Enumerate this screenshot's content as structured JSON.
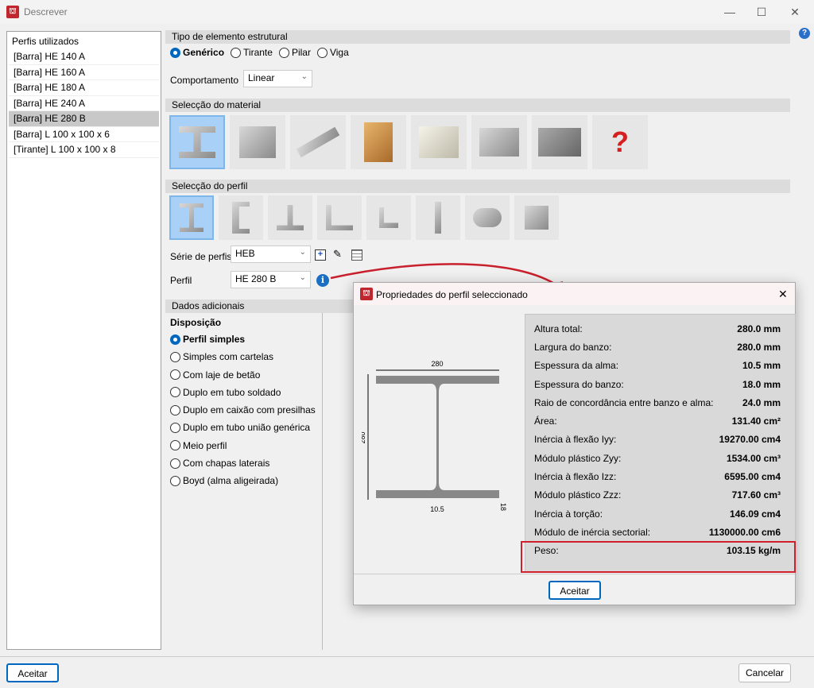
{
  "window": {
    "title": "Descrever",
    "help": "?"
  },
  "profiles_list": {
    "header": "Perfis utilizados",
    "items": [
      "[Barra] HE 140 A",
      "[Barra] HE 160 A",
      "[Barra] HE 180 A",
      "[Barra] HE 240 A",
      "[Barra] HE 280 B",
      "[Barra] L 100 x 100 x 6",
      "[Tirante] L 100 x 100 x 8"
    ],
    "selected_index": 4
  },
  "element_type": {
    "title": "Tipo de elemento estrutural",
    "options": [
      "Genérico",
      "Tirante",
      "Pilar",
      "Viga"
    ],
    "selected": "Genérico"
  },
  "behaviour": {
    "label": "Comportamento",
    "value": "Linear"
  },
  "material": {
    "title": "Selecção do material",
    "icons": [
      "steel-rolled-icon",
      "steel-welded-icon",
      "cold-formed-icon",
      "timber-icon",
      "aluminium-extruded-icon",
      "aluminium-profiles-icon",
      "concrete-icon",
      "generic-section-icon"
    ],
    "selected_index": 0
  },
  "profile_select": {
    "title": "Selecção do perfil",
    "icons": [
      "i-section-icon",
      "c-section-icon",
      "t-section-icon",
      "l-section-icon",
      "small-l-section-icon",
      "plate-icon",
      "round-bar-icon",
      "square-bar-icon"
    ],
    "selected_index": 0
  },
  "series": {
    "label": "Série de perfis",
    "value": "HEB"
  },
  "profile": {
    "label": "Perfil",
    "value": "HE 280 B"
  },
  "additional": {
    "title": "Dados adicionais",
    "disposition_label": "Disposição",
    "options": [
      "Perfil simples",
      "Simples com cartelas",
      "Com laje de betão",
      "Duplo em tubo soldado",
      "Duplo em caixão com presilhas",
      "Duplo em tubo união genérica",
      "Meio perfil",
      "Com chapas laterais",
      "Boyd (alma aligeirada)"
    ],
    "selected": "Perfil simples"
  },
  "footer": {
    "accept": "Aceitar",
    "cancel": "Cancelar"
  },
  "popup": {
    "title": "Propriedades do perfil seleccionado",
    "accept": "Aceitar",
    "drawing": {
      "width": "280",
      "height": "280",
      "web": "10.5",
      "flange": "18"
    },
    "properties": [
      {
        "label": "Altura total:",
        "value": "280.0 mm"
      },
      {
        "label": "Largura do banzo:",
        "value": "280.0 mm"
      },
      {
        "label": "Espessura da alma:",
        "value": "10.5 mm"
      },
      {
        "label": "Espessura do banzo:",
        "value": "18.0 mm"
      },
      {
        "label": "Raio de concordância entre banzo e alma:",
        "value": "24.0 mm"
      },
      {
        "label": "Área:",
        "value": "131.40 cm²"
      },
      {
        "label": "Inércia à flexão Iyy:",
        "value": "19270.00 cm4"
      },
      {
        "label": "Módulo plástico Zyy:",
        "value": "1534.00 cm³"
      },
      {
        "label": "Inércia à flexão Izz:",
        "value": "6595.00 cm4"
      },
      {
        "label": "Módulo plástico Zzz:",
        "value": "717.60 cm³"
      },
      {
        "label": "Inércia à torção:",
        "value": "146.09 cm4"
      },
      {
        "label": "Módulo de inércia sectorial:",
        "value": "1130000.00 cm6"
      },
      {
        "label": "Peso:",
        "value": "103.15 kg/m"
      }
    ],
    "highlight_color": "#d0202e"
  }
}
